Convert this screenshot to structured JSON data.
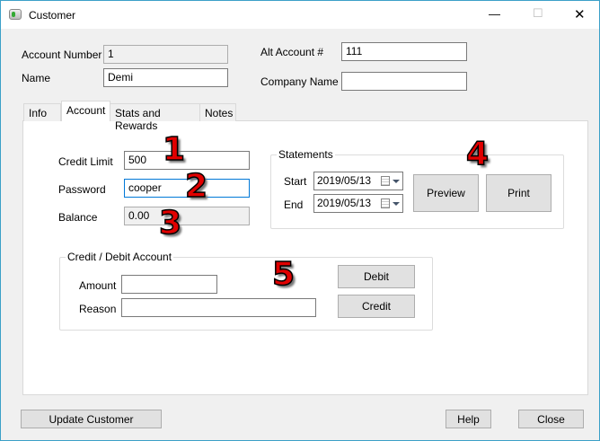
{
  "window": {
    "title": "Customer",
    "minimize": "—",
    "maximize": "☐",
    "close": "✕"
  },
  "header": {
    "account_number_label": "Account Number",
    "account_number": "1",
    "name_label": "Name",
    "name": "Demi",
    "alt_account_label": "Alt Account #",
    "alt_account": "111",
    "company_label": "Company Name",
    "company": ""
  },
  "tabs": [
    {
      "label": "Info"
    },
    {
      "label": "Account"
    },
    {
      "label": "Stats and Rewards"
    },
    {
      "label": "Notes"
    }
  ],
  "account": {
    "credit_limit_label": "Credit Limit",
    "credit_limit": "500",
    "password_label": "Password",
    "password": "cooper",
    "balance_label": "Balance",
    "balance": "0.00"
  },
  "statements": {
    "title": "Statements",
    "start_label": "Start",
    "start": "2019/05/13",
    "end_label": "End",
    "end": "2019/05/13",
    "preview": "Preview",
    "print": "Print"
  },
  "credit_debit": {
    "title": "Credit / Debit Account",
    "amount_label": "Amount",
    "amount": "",
    "reason_label": "Reason",
    "reason": "",
    "debit": "Debit",
    "credit": "Credit"
  },
  "annotations": [
    "1",
    "2",
    "3",
    "4",
    "5"
  ],
  "footer": {
    "update": "Update Customer",
    "help": "Help",
    "close": "Close"
  },
  "colors": {
    "annotation": "#e00000",
    "focus": "#0078d7"
  }
}
